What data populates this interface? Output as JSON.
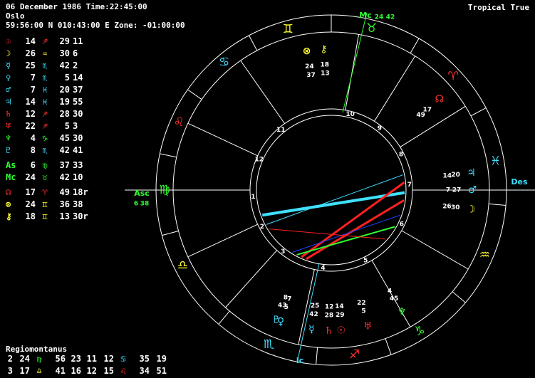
{
  "header": {
    "line1": "06 December 1986 Time:22:45:00",
    "line2": "Oslo",
    "line3": "59:56:00 N 010:43:00 E Zone: -01:00:00",
    "mode": "Tropical True"
  },
  "planets": [
    {
      "glyph": "☉",
      "gcolor": "#ff3030",
      "deg": "14",
      "sign": "♐",
      "scolor": "#ff3030",
      "min": "29",
      "sec": "11",
      "gap": false
    },
    {
      "glyph": "☽",
      "gcolor": "#ffff30",
      "deg": "26",
      "sign": "♒",
      "scolor": "#ffff30",
      "min": "30",
      "sec": "6",
      "gap": false
    },
    {
      "glyph": "☿",
      "gcolor": "#40e0ff",
      "deg": "25",
      "sign": "♏",
      "scolor": "#40e0ff",
      "min": "42",
      "sec": "2",
      "gap": false
    },
    {
      "glyph": "♀",
      "gcolor": "#40e0ff",
      "deg": "7",
      "sign": "♏",
      "scolor": "#40e0ff",
      "min": "5",
      "sec": "14",
      "gap": false
    },
    {
      "glyph": "♂",
      "gcolor": "#40e0ff",
      "deg": "7",
      "sign": "♓",
      "scolor": "#40e0ff",
      "min": "20",
      "sec": "37",
      "gap": false
    },
    {
      "glyph": "♃",
      "gcolor": "#40e0ff",
      "deg": "14",
      "sign": "♓",
      "scolor": "#40e0ff",
      "min": "19",
      "sec": "55",
      "gap": false
    },
    {
      "glyph": "♄",
      "gcolor": "#ff3030",
      "deg": "12",
      "sign": "♐",
      "scolor": "#ff3030",
      "min": "28",
      "sec": "30",
      "gap": false
    },
    {
      "glyph": "♅",
      "gcolor": "#ff3030",
      "deg": "22",
      "sign": "♐",
      "scolor": "#ff3030",
      "min": "5",
      "sec": "3",
      "gap": false
    },
    {
      "glyph": "♆",
      "gcolor": "#30ff30",
      "deg": "4",
      "sign": "♑",
      "scolor": "#30ff30",
      "min": "45",
      "sec": "30",
      "gap": false
    },
    {
      "glyph": "♇",
      "gcolor": "#40e0ff",
      "deg": "8",
      "sign": "♏",
      "scolor": "#40e0ff",
      "min": "42",
      "sec": "41",
      "gap": false
    },
    {
      "glyph": "As",
      "gcolor": "#30ff30",
      "deg": "6",
      "sign": "♍",
      "scolor": "#30ff30",
      "min": "37",
      "sec": "33",
      "gap": true
    },
    {
      "glyph": "Mc",
      "gcolor": "#30ff30",
      "deg": "24",
      "sign": "♉",
      "scolor": "#30ff30",
      "min": "42",
      "sec": "10",
      "gap": false
    },
    {
      "glyph": "☊",
      "gcolor": "#ff3030",
      "deg": "17",
      "sign": "♈",
      "scolor": "#ff3030",
      "min": "49",
      "sec": "18r",
      "gap": true
    },
    {
      "glyph": "⊗",
      "gcolor": "#ffff30",
      "deg": "24",
      "sign": "♊",
      "scolor": "#ffff30",
      "min": "36",
      "sec": "38",
      "gap": false
    },
    {
      "glyph": "⚷",
      "gcolor": "#ffff30",
      "deg": "18",
      "sign": "♊",
      "scolor": "#ffff30",
      "min": "13",
      "sec": "30r",
      "gap": false
    }
  ],
  "houses": {
    "title": "Regiomontanus",
    "rows": [
      [
        {
          "t": "2",
          "c": "#ffffff"
        },
        {
          "t": "24",
          "c": "#ffffff"
        },
        {
          "t": "♍",
          "c": "#30ff30"
        },
        {
          "t": "56",
          "c": "#ffffff"
        },
        {
          "t": "23",
          "c": "#ffffff"
        },
        {
          "t": "11",
          "c": "#ffffff"
        },
        {
          "t": "12",
          "c": "#ffffff"
        },
        {
          "t": "♋",
          "c": "#40e0ff"
        },
        {
          "t": "35",
          "c": "#ffffff"
        },
        {
          "t": "19",
          "c": "#ffffff"
        }
      ],
      [
        {
          "t": "3",
          "c": "#ffffff"
        },
        {
          "t": "17",
          "c": "#ffffff"
        },
        {
          "t": "♎",
          "c": "#ffff30"
        },
        {
          "t": "41",
          "c": "#ffffff"
        },
        {
          "t": "16",
          "c": "#ffffff"
        },
        {
          "t": "12",
          "c": "#ffffff"
        },
        {
          "t": "15",
          "c": "#ffffff"
        },
        {
          "t": "♌",
          "c": "#ff3030"
        },
        {
          "t": "34",
          "c": "#ffffff"
        },
        {
          "t": "51",
          "c": "#ffffff"
        }
      ]
    ]
  },
  "wheel": {
    "signs": [
      {
        "glyph": "♊",
        "color": "#ffff30",
        "angle": 105
      },
      {
        "glyph": "♉",
        "color": "#30ff30",
        "angle": 76
      },
      {
        "glyph": "♈",
        "color": "#ff3030",
        "angle": 43
      },
      {
        "glyph": "♓",
        "color": "#40e0ff",
        "angle": 10
      },
      {
        "glyph": "♒",
        "color": "#ffff30",
        "angle": -23
      },
      {
        "glyph": "♑",
        "color": "#30ff30",
        "angle": -58
      },
      {
        "glyph": "♐",
        "color": "#ff3030",
        "angle": -82
      },
      {
        "glyph": "♏",
        "color": "#40e0ff",
        "angle": -112
      },
      {
        "glyph": "♎",
        "color": "#ffff30",
        "angle": -153
      },
      {
        "glyph": "♍",
        "color": "#30ff30",
        "angle": 180
      },
      {
        "glyph": "♌",
        "color": "#ff3030",
        "angle": 156
      },
      {
        "glyph": "♋",
        "color": "#40e0ff",
        "angle": 130
      }
    ],
    "cusp_numbers": [
      "1",
      "2",
      "3",
      "4",
      "5",
      "6",
      "7",
      "8",
      "9",
      "10",
      "11",
      "12"
    ],
    "angles": {
      "mc": {
        "label": "Mc",
        "deg": "24",
        "min": "42"
      },
      "asc": {
        "label": "Asc",
        "deg": "6",
        "min": "38"
      },
      "des": {
        "label": "Des"
      },
      "ic": {
        "label": "Ic"
      }
    },
    "bodies": [
      {
        "glyph": "⊗",
        "color": "#ffff30",
        "deg": "24",
        "min": "37",
        "angle": 100
      },
      {
        "glyph": "⚷",
        "color": "#ffff30",
        "deg": "18",
        "min": "13",
        "angle": 93
      },
      {
        "glyph": "☊",
        "color": "#ff3030",
        "deg": "17",
        "min": "49",
        "angle": 40
      },
      {
        "glyph": "♃",
        "color": "#40e0ff",
        "deg": "20",
        "min": "14",
        "angle": 7
      },
      {
        "glyph": "♂",
        "color": "#40e0ff",
        "deg": "27",
        "min": "7",
        "angle": 0
      },
      {
        "glyph": "☽",
        "color": "#ffff30",
        "deg": "30",
        "min": "26",
        "angle": -8
      },
      {
        "glyph": "♆",
        "color": "#30ff30",
        "deg": "45",
        "min": "4",
        "angle": -60
      },
      {
        "glyph": "♅",
        "color": "#ff3030",
        "deg": "5",
        "min": "22",
        "angle": -75
      },
      {
        "glyph": "☉",
        "color": "#ff3030",
        "deg": "29",
        "min": "14",
        "angle": -86
      },
      {
        "glyph": "♄",
        "color": "#ff3030",
        "deg": "28",
        "min": "12",
        "angle": -91
      },
      {
        "glyph": "☿",
        "color": "#40e0ff",
        "deg": "42",
        "min": "25",
        "angle": -98
      },
      {
        "glyph": "♀",
        "color": "#40e0ff",
        "deg": "5",
        "min": "7",
        "angle": -111
      },
      {
        "glyph": "♇",
        "color": "#40e0ff",
        "deg": "43",
        "min": "8",
        "angle": -113
      }
    ]
  }
}
